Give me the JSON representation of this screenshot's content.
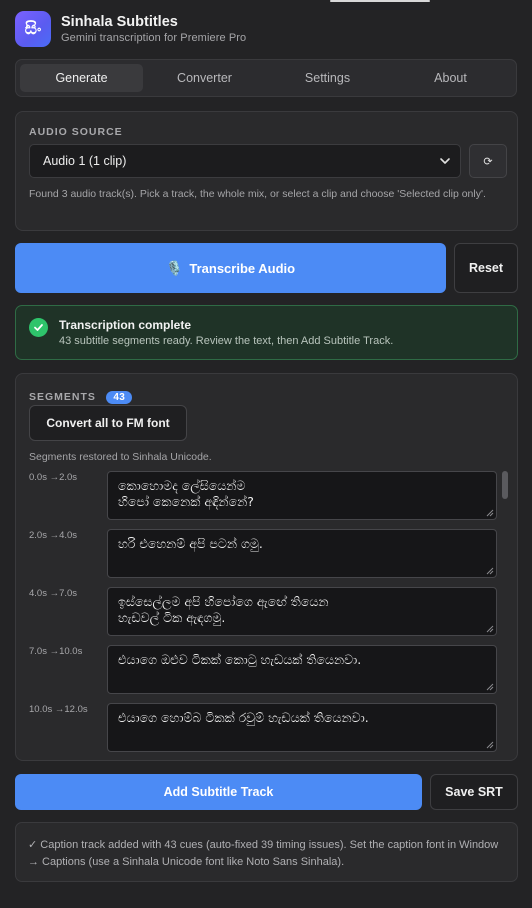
{
  "app": {
    "logo_glyph": "සිං",
    "title": "Sinhala Subtitles",
    "subtitle": "Gemini transcription for Premiere Pro"
  },
  "tabs": [
    {
      "label": "Generate",
      "active": true
    },
    {
      "label": "Converter",
      "active": false
    },
    {
      "label": "Settings",
      "active": false
    },
    {
      "label": "About",
      "active": false
    }
  ],
  "audio_source": {
    "label": "AUDIO SOURCE",
    "selected": "Audio 1 (1 clip)",
    "refresh_glyph": "⟳",
    "hint": "Found 3 audio track(s). Pick a track, the whole mix, or select a clip and choose 'Selected clip only'."
  },
  "actions": {
    "transcribe_icon": "🎙️",
    "transcribe_label": "Transcribe Audio",
    "reset_label": "Reset"
  },
  "status": {
    "title": "Transcription complete",
    "text": "43 subtitle segments ready. Review the text, then Add Subtitle Track."
  },
  "segments": {
    "label": "SEGMENTS",
    "count": "43",
    "convert_label": "Convert all to FM font",
    "restored_text": "Segments restored to Sinhala Unicode.",
    "items": [
      {
        "time": "0.0s →2.0s",
        "text": "කොහොමද ලේසියෙන්ම\nහිපෝ කෙනෙක් අඳින්නේ?"
      },
      {
        "time": "2.0s →4.0s",
        "text": "හරි එහෙනම් අපි පටන් ගමු."
      },
      {
        "time": "4.0s →7.0s",
        "text": "ඉස්සෙල්ලම අපි හිපෝගෙ ඇඟේ තියෙන\nහැඩවල් ටික ඇඳගමු."
      },
      {
        "time": "7.0s →10.0s",
        "text": "එයාගෙ ඔළුව ටිකක් කොටු හැඩයක් තියෙනවා."
      },
      {
        "time": "10.0s →12.0s",
        "text": "එයාගෙ හොම්බ ටිකක් රවුම් හැඩයක් තියෙනවා."
      }
    ]
  },
  "bottom_actions": {
    "add_label": "Add Subtitle Track",
    "save_label": "Save SRT"
  },
  "footer": {
    "text": "✓ Caption track added with 43 cues (auto-fixed 39 timing issues). Set the caption font in Window → Captions (use a Sinhala Unicode font like Noto Sans Sinhala)."
  },
  "colors": {
    "accent": "#4c8bf5",
    "success": "#2ec46b",
    "background": "#232325"
  }
}
